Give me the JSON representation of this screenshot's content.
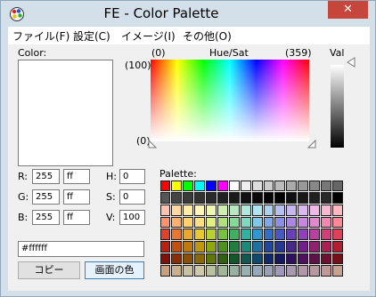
{
  "window": {
    "title": "FE - Color Palette",
    "close_label": "✕"
  },
  "menu": [
    "ファイル(F)",
    "設定(C)",
    "イメージ(I)",
    "その他(O)"
  ],
  "color": {
    "label": "Color:",
    "current": "#ffffff"
  },
  "huesat": {
    "label": "Hue/Sat",
    "x_min": "(0)",
    "x_max": "(359)",
    "y_max": "(100)",
    "y_min": "(0)"
  },
  "val_label": "Val",
  "fields": {
    "r": {
      "label": "R:",
      "dec": "255",
      "hex": "ff"
    },
    "g": {
      "label": "G:",
      "dec": "255",
      "hex": "ff"
    },
    "b": {
      "label": "B:",
      "dec": "255",
      "hex": "ff"
    },
    "h": {
      "label": "H:",
      "value": "0"
    },
    "s": {
      "label": "S:",
      "value": "0"
    },
    "v": {
      "label": "V:",
      "value": "100"
    }
  },
  "hex_value": "#ffffff",
  "buttons": {
    "copy": "コピー",
    "screen_color": "画面の色"
  },
  "palette": {
    "label": "Palette:",
    "colors": [
      "#ff0000",
      "#ffff00",
      "#00ff00",
      "#00ffff",
      "#0000ff",
      "#ff00ff",
      "#ffffff",
      "#eeeeee",
      "#dddddd",
      "#cccccc",
      "#bbbbbb",
      "#aaaaaa",
      "#999999",
      "#888888",
      "#777777",
      "#666666",
      "#555555",
      "#444444",
      "#3a3a3a",
      "#333333",
      "#2a2a2a",
      "#222222",
      "#1a1a1a",
      "#111111",
      "#0a0a0a",
      "#050505",
      "#000000",
      "#101010",
      "#181818",
      "#202020",
      "#282828",
      "#000000",
      "#ffc0b0",
      "#ffd9a0",
      "#ffecaa",
      "#fff5b8",
      "#eff8b0",
      "#cfeeb0",
      "#b8e8c0",
      "#b0e8dc",
      "#b0e4f0",
      "#b0d0f0",
      "#b8c0f0",
      "#c8b8f0",
      "#dcb8f0",
      "#f0b8e8",
      "#f8b8d0",
      "#ffb8c0",
      "#ff9070",
      "#ffb070",
      "#ffd070",
      "#ffe080",
      "#e0f080",
      "#b0e080",
      "#88d898",
      "#80d8c0",
      "#80c8e8",
      "#80a8e8",
      "#8c90e0",
      "#a888e0",
      "#c888e0",
      "#e088d0",
      "#f088b0",
      "#ff8898",
      "#e04030",
      "#e87830",
      "#e8a830",
      "#e8c830",
      "#b8d030",
      "#78c040",
      "#40b060",
      "#30b0a0",
      "#3098d0",
      "#3070c8",
      "#4858c0",
      "#6840b8",
      "#9040b8",
      "#b840a0",
      "#d04078",
      "#e04058",
      "#b82010",
      "#c05010",
      "#c07810",
      "#c09810",
      "#90a810",
      "#509020",
      "#208040",
      "#208878",
      "#2070a0",
      "#2048a0",
      "#283890",
      "#482888",
      "#702088",
      "#902070",
      "#a82050",
      "#b02030",
      "#801008",
      "#883008",
      "#885008",
      "#886808",
      "#607808",
      "#306010",
      "#105828",
      "#105850",
      "#104870",
      "#102870",
      "#181860",
      "#301060",
      "#501060",
      "#601048",
      "#701030",
      "#781018",
      "#c8a080",
      "#c8b090",
      "#c8c0a0",
      "#d0c8a8",
      "#b8c0a0",
      "#a0b898",
      "#98b0a0",
      "#98b0b0",
      "#98a8b8",
      "#98a0b8",
      "#a098b8",
      "#a898b0",
      "#b098a8",
      "#b898a0",
      "#c09898",
      "#c8a090"
    ]
  }
}
